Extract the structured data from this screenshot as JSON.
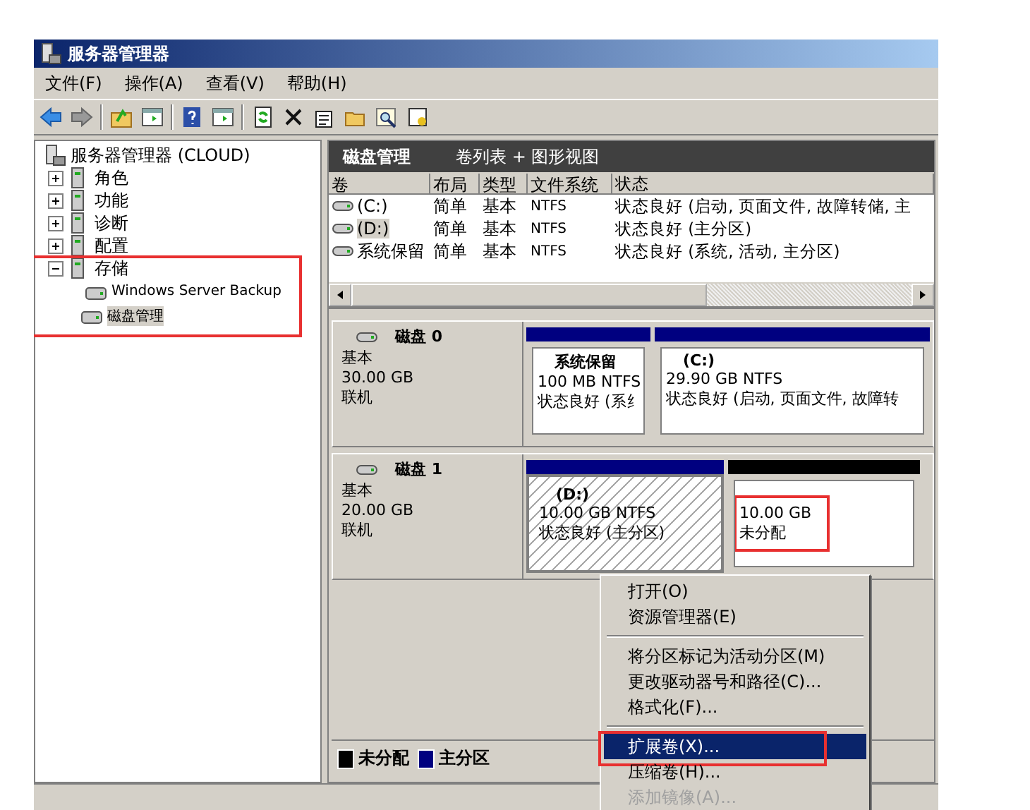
{
  "window": {
    "title": "服务器管理器"
  },
  "menu_bar": [
    "文件(F)",
    "操作(A)",
    "查看(V)",
    "帮助(H)"
  ],
  "tree": {
    "label": "服务器管理器 (CLOUD)",
    "children": [
      {
        "label": "角色",
        "expanded": false,
        "annotated": false
      },
      {
        "label": "功能",
        "expanded": false,
        "annotated": false
      },
      {
        "label": "诊断",
        "expanded": false,
        "annotated": false
      },
      {
        "label": "配置",
        "expanded": false,
        "annotated": false
      },
      {
        "label": "存储",
        "expanded": true,
        "annotated": true,
        "children": [
          {
            "label": "Windows Server Backup",
            "selected": false
          },
          {
            "label": "磁盘管理",
            "selected": true
          }
        ]
      }
    ]
  },
  "pane_header": {
    "title": "磁盘管理",
    "subtitle": "卷列表 + 图形视图"
  },
  "volume_table": {
    "columns": [
      "卷",
      "布局",
      "类型",
      "文件系统",
      "状态"
    ],
    "rows": [
      {
        "cells": [
          "(C:)",
          "简单",
          "基本",
          "NTFS",
          "状态良好 (启动, 页面文件, 故障转储, 主"
        ],
        "selected": false
      },
      {
        "cells": [
          "(D:)",
          "简单",
          "基本",
          "NTFS",
          "状态良好 (主分区)"
        ],
        "selected": true
      },
      {
        "cells": [
          "系统保留",
          "简单",
          "基本",
          "NTFS",
          "状态良好 (系统, 活动, 主分区)"
        ],
        "selected": false
      }
    ]
  },
  "disks": [
    {
      "name": "磁盘 0",
      "type": "基本",
      "size": "30.00 GB",
      "status": "联机",
      "partitions": [
        {
          "kind": "primary",
          "title": "系统保留",
          "detail": "100 MB NTFS",
          "status": "状态良好 (系纟",
          "selected": false,
          "annotated": false
        },
        {
          "kind": "primary",
          "title": "(C:)",
          "detail": "29.90 GB NTFS",
          "status": "状态良好 (启动, 页面文件, 故障转",
          "selected": false,
          "annotated": false
        }
      ]
    },
    {
      "name": "磁盘 1",
      "type": "基本",
      "size": "20.00 GB",
      "status": "联机",
      "partitions": [
        {
          "kind": "primary",
          "title": "(D:)",
          "detail": "10.00 GB NTFS",
          "status": "状态良好 (主分区)",
          "selected": true,
          "annotated": false
        },
        {
          "kind": "unallocated",
          "detail": "10.00 GB",
          "status": "未分配",
          "selected": false,
          "annotated": true
        }
      ]
    }
  ],
  "legend": [
    {
      "label": "未分配",
      "color": "#000000"
    },
    {
      "label": "主分区",
      "color": "#000080"
    }
  ],
  "context_menu": [
    {
      "kind": "item",
      "label": "打开(O)",
      "selected": false,
      "disabled": false,
      "annotated": false
    },
    {
      "kind": "item",
      "label": "资源管理器(E)",
      "selected": false,
      "disabled": false,
      "annotated": false
    },
    {
      "kind": "separator"
    },
    {
      "kind": "item",
      "label": "将分区标记为活动分区(M)",
      "selected": false,
      "disabled": false,
      "annotated": false
    },
    {
      "kind": "item",
      "label": "更改驱动器号和路径(C)...",
      "selected": false,
      "disabled": false,
      "annotated": false
    },
    {
      "kind": "item",
      "label": "格式化(F)...",
      "selected": false,
      "disabled": false,
      "annotated": false
    },
    {
      "kind": "separator"
    },
    {
      "kind": "item",
      "label": "扩展卷(X)...",
      "selected": true,
      "disabled": false,
      "annotated": true
    },
    {
      "kind": "item",
      "label": "压缩卷(H)...",
      "selected": false,
      "disabled": false,
      "annotated": false
    },
    {
      "kind": "item",
      "label": "添加镜像(A)...",
      "selected": false,
      "disabled": true,
      "annotated": false
    }
  ]
}
